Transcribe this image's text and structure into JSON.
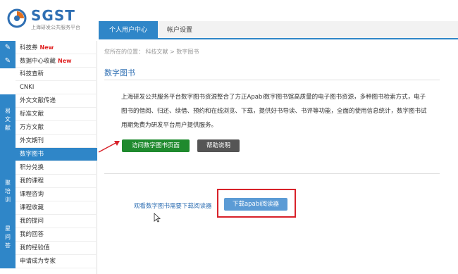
{
  "header": {
    "logo_text": "SGST",
    "logo_subtitle": "上海研发公共服务平台",
    "tabs": [
      {
        "label": "个人用户中心"
      },
      {
        "label": "帐户设置"
      }
    ]
  },
  "sidebar": {
    "groups": [
      {
        "label": "",
        "icon": "pen-icon",
        "items": [
          {
            "label": "科技券",
            "badge": "New"
          }
        ]
      },
      {
        "label": "",
        "icon": "pen-icon",
        "items": [
          {
            "label": "数据中心收藏",
            "badge": "New"
          }
        ]
      },
      {
        "label": "",
        "items": [
          {
            "label": "科技查新"
          },
          {
            "label": "CNKI"
          }
        ]
      },
      {
        "label": "易文献",
        "items": [
          {
            "label": "外文文献传递"
          },
          {
            "label": "标准文献"
          },
          {
            "label": "万方文献"
          },
          {
            "label": "外文期刊"
          },
          {
            "label": "数字图书"
          },
          {
            "label": "积分兑换"
          }
        ]
      },
      {
        "label": "聚培训",
        "items": [
          {
            "label": "我的课程"
          },
          {
            "label": "课程咨询"
          },
          {
            "label": "课程收藏"
          }
        ]
      },
      {
        "label": "星问答",
        "items": [
          {
            "label": "我的提问"
          },
          {
            "label": "我的回答"
          },
          {
            "label": "我的经验值"
          },
          {
            "label": "申请成为专家"
          }
        ]
      }
    ],
    "active_item": "数字图书"
  },
  "main": {
    "breadcrumb": "您所在的位置： 科技文献 > 数字图书",
    "title": "数字图书",
    "description": "上海研发公共服务平台数字图书资源整合了方正Apabi数字图书馆高质量的电子图书资源，多种图书检索方式，电子图书的借阅、归还、续借、预约和在线浏览、下载，提供好书导读、书评等功能，全面的使用信息统计，数字图书试用期免费为研发平台用户提供服务。",
    "visit_button": "访问数字图书页面",
    "help_button": "帮助说明",
    "reader_note": "观看数字图书需要下载阅读器",
    "download_button": "下载apabi阅读器"
  },
  "colors": {
    "accent": "#2f86c8",
    "visit_button": "#1f8a2e",
    "help_button": "#555555",
    "download_button": "#5b9bd5",
    "highlight": "#d8222a",
    "new_badge": "#e02020"
  }
}
